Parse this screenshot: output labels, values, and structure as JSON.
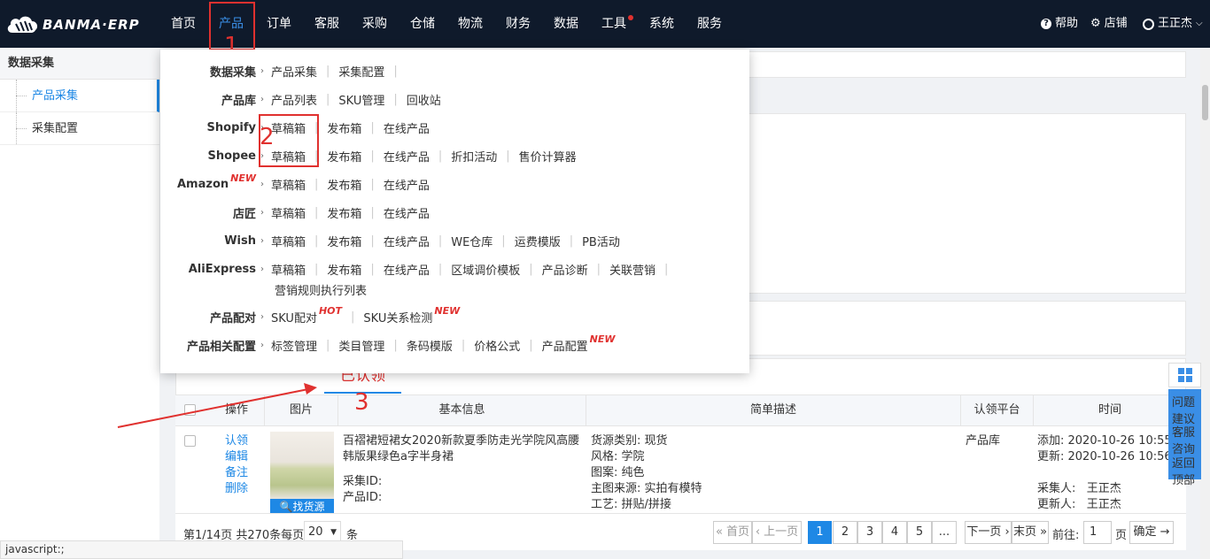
{
  "brand": {
    "name": "BANMA·ERP"
  },
  "topnav": {
    "items": [
      "首页",
      "产品",
      "订单",
      "客服",
      "采购",
      "仓储",
      "物流",
      "财务",
      "数据",
      "工具",
      "系统",
      "服务"
    ],
    "active": "产品",
    "right": {
      "help": "帮助",
      "store": "店铺",
      "user": "王正杰"
    }
  },
  "annotations": {
    "one": "1",
    "two": "2",
    "three": "3"
  },
  "sidebar": {
    "title": "数据采集",
    "items": [
      {
        "label": "产品采集"
      },
      {
        "label": "采集配置"
      }
    ]
  },
  "dropdown": {
    "rows": [
      {
        "label": "数据采集",
        "links": [
          "产品采集",
          "采集配置"
        ]
      },
      {
        "label": "产品库",
        "links": [
          "产品列表",
          "SKU管理",
          "回收站"
        ]
      },
      {
        "label": "Shopify",
        "links": [
          "草稿箱",
          "发布箱",
          "在线产品"
        ]
      },
      {
        "label": "Shopee",
        "links": [
          "草稿箱",
          "发布箱",
          "在线产品",
          "折扣活动",
          "售价计算器"
        ]
      },
      {
        "label": "Amazon",
        "label_badge": "NEW",
        "links": [
          "草稿箱",
          "发布箱",
          "在线产品"
        ]
      },
      {
        "label": "店匠",
        "links": [
          "草稿箱",
          "发布箱",
          "在线产品"
        ]
      },
      {
        "label": "Wish",
        "links": [
          "草稿箱",
          "发布箱",
          "在线产品",
          "WE仓库",
          "运费模版",
          "PB活动"
        ]
      },
      {
        "label": "AliExpress",
        "links": [
          "草稿箱",
          "发布箱",
          "在线产品",
          "区域调价模板",
          "产品诊断",
          "关联营销"
        ],
        "links2": [
          "营销规则执行列表"
        ]
      },
      {
        "label": "产品配对",
        "links": [
          "SKU配对",
          "SKU关系检测"
        ],
        "badges": {
          "SKU配对": "HOT",
          "SKU关系检测": "NEW"
        }
      },
      {
        "label": "产品相关配置",
        "links": [
          "标签管理",
          "类目管理",
          "条码模版",
          "价格公式",
          "产品配置"
        ],
        "badges": {
          "产品配置": "NEW"
        }
      }
    ]
  },
  "tabs": {
    "active": "已认领"
  },
  "table": {
    "headers": [
      "操作",
      "图片",
      "基本信息",
      "简单描述",
      "认领平台",
      "时间"
    ],
    "row": {
      "actions": [
        "认领",
        "编辑",
        "备注",
        "删除"
      ],
      "image_button": "找货源",
      "title": "百褶裙短裙女2020新款夏季防走光学院风高腰韩版果绿色a字半身裙",
      "collect_id_label": "采集ID:",
      "product_id_label": "产品ID:",
      "desc": [
        "货源类别: 现货",
        "风格: 学院",
        "图案: 纯色",
        "主图来源: 实拍有模特",
        "工艺: 拼贴/拼接"
      ],
      "platform": "产品库",
      "time": {
        "added": "添加: 2020-10-26 10:55:",
        "updated": "更新: 2020-10-26 10:56:",
        "collector": "采集人:   王正杰",
        "updater": "更新人:   王正杰"
      }
    }
  },
  "pager": {
    "summary": "第1/14页 共270条每页",
    "page_size": "20",
    "unit": "条",
    "first": "« 首页",
    "prev": "‹ 上一页",
    "pages": [
      "1",
      "2",
      "3",
      "4",
      "5",
      "..."
    ],
    "current": "1",
    "next": "下一页 ›",
    "last": "末页 »",
    "goto_label": "前往:",
    "goto_value": "1",
    "page_unit": "页",
    "confirm": "确定 →"
  },
  "float_bar": {
    "items": [
      "问题建议",
      "客服咨询",
      "返回顶部"
    ]
  },
  "status_bar": {
    "text": "javascript:;"
  }
}
